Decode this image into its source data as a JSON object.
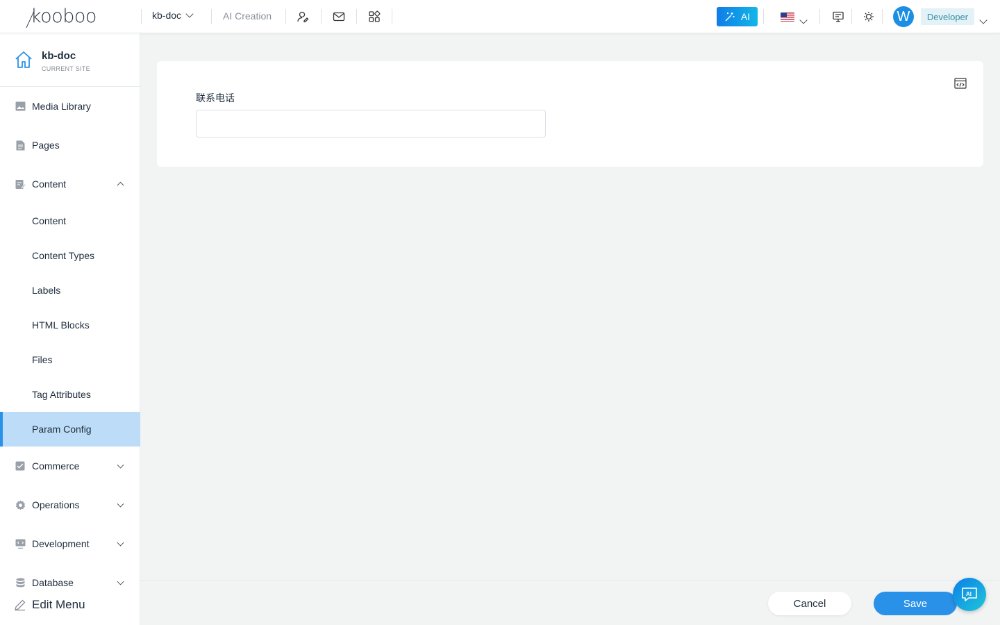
{
  "header": {
    "logo": "kooboo",
    "site_switch": "kb-doc",
    "ai_creation": "AI Creation",
    "ai_button": "AI",
    "avatar_initial": "W",
    "role": "Developer",
    "icons": [
      "user-edit-icon",
      "mail-icon",
      "apps-grid-icon",
      "monitor-icon",
      "theme-sun-icon"
    ],
    "language_flag": "us-flag-icon",
    "accent_color": "#2a91e8"
  },
  "sidebar": {
    "site_name": "kb-doc",
    "site_caption": "CURRENT SITE",
    "items": [
      {
        "label": "Media Library",
        "icon": "image-icon"
      },
      {
        "label": "Pages",
        "icon": "page-icon"
      },
      {
        "label": "Content",
        "icon": "content-edit-icon",
        "expanded": true
      },
      {
        "label": "Content"
      },
      {
        "label": "Content Types"
      },
      {
        "label": "Labels"
      },
      {
        "label": "HTML Blocks"
      },
      {
        "label": "Files"
      },
      {
        "label": "Tag Attributes"
      },
      {
        "label": "Param Config",
        "active": true
      },
      {
        "label": "Commerce",
        "icon": "commerce-icon"
      },
      {
        "label": "Operations",
        "icon": "gear-icon"
      },
      {
        "label": "Development",
        "icon": "development-icon"
      },
      {
        "label": "Database",
        "icon": "database-icon"
      }
    ],
    "edit_menu": "Edit Menu"
  },
  "main": {
    "field_label": "联系电话",
    "field_value": ""
  },
  "footer": {
    "cancel": "Cancel",
    "save": "Save"
  }
}
